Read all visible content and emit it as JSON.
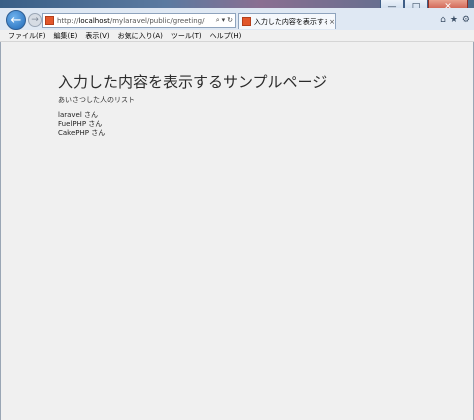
{
  "browser": {
    "url_prefix": "http://",
    "url_host": "localhost",
    "url_path": "/mylaravel/public/greeting/all",
    "addr_icons": [
      "⌕",
      "▾",
      "↻"
    ],
    "tab_title": "入力した内容を表示する…",
    "tab_close": "×",
    "window_buttons": [
      "—",
      "□",
      "✕"
    ],
    "right_icons": [
      "⌂",
      "★",
      "⚙"
    ]
  },
  "menubar": {
    "items": [
      "ファイル(F)",
      "編集(E)",
      "表示(V)",
      "お気に入り(A)",
      "ツール(T)",
      "ヘルプ(H)"
    ]
  },
  "page": {
    "title": "入力した内容を表示するサンプルページ",
    "subtitle": "あいさつした人のリスト",
    "list": [
      "laravel さん",
      "FuelPHP さん",
      "CakePHP さん"
    ]
  }
}
